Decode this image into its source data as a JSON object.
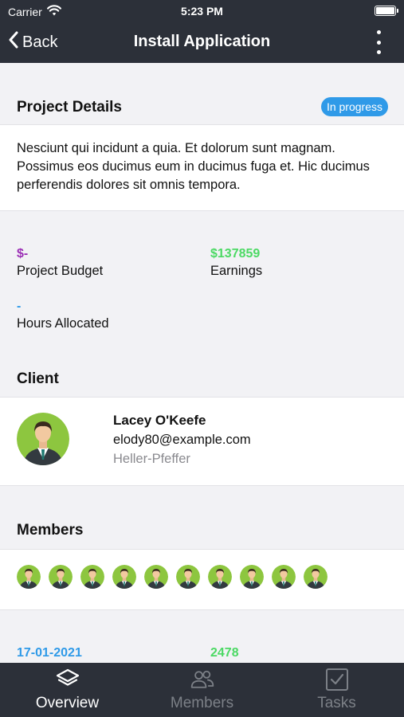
{
  "status_bar": {
    "carrier": "Carrier",
    "time": "5:23 PM"
  },
  "nav": {
    "back_label": "Back",
    "title": "Install Application"
  },
  "project": {
    "heading": "Project Details",
    "status_badge": "In progress",
    "description": "Nesciunt qui incidunt a quia. Et dolorum sunt magnam. Possimus eos ducimus eum in ducimus fuga et. Hic ducimus perferendis dolores sit omnis tempora."
  },
  "stats": {
    "budget_value": "$-",
    "budget_label": "Project Budget",
    "earnings_value": "$137859",
    "earnings_label": "Earnings",
    "hours_value": "-",
    "hours_label": "Hours Allocated",
    "date_value": "17-01-2021",
    "count_value": "2478"
  },
  "client": {
    "heading": "Client",
    "name": "Lacey O'Keefe",
    "email": "elody80@example.com",
    "company": "Heller-Pfeffer"
  },
  "members": {
    "heading": "Members",
    "count": 10
  },
  "tabs": [
    {
      "label": "Overview",
      "icon": "layers-icon",
      "active": true
    },
    {
      "label": "Members",
      "icon": "people-icon",
      "active": false
    },
    {
      "label": "Tasks",
      "icon": "checkbox-icon",
      "active": false
    }
  ],
  "colors": {
    "header_bg": "#2c3039",
    "badge": "#2f9ae8",
    "budget": "#9b2fb5",
    "earnings": "#4cd964",
    "hours": "#2f9ae8",
    "date": "#2f9ae8",
    "count": "#4cd964",
    "avatar_bg": "#8dc63f"
  }
}
